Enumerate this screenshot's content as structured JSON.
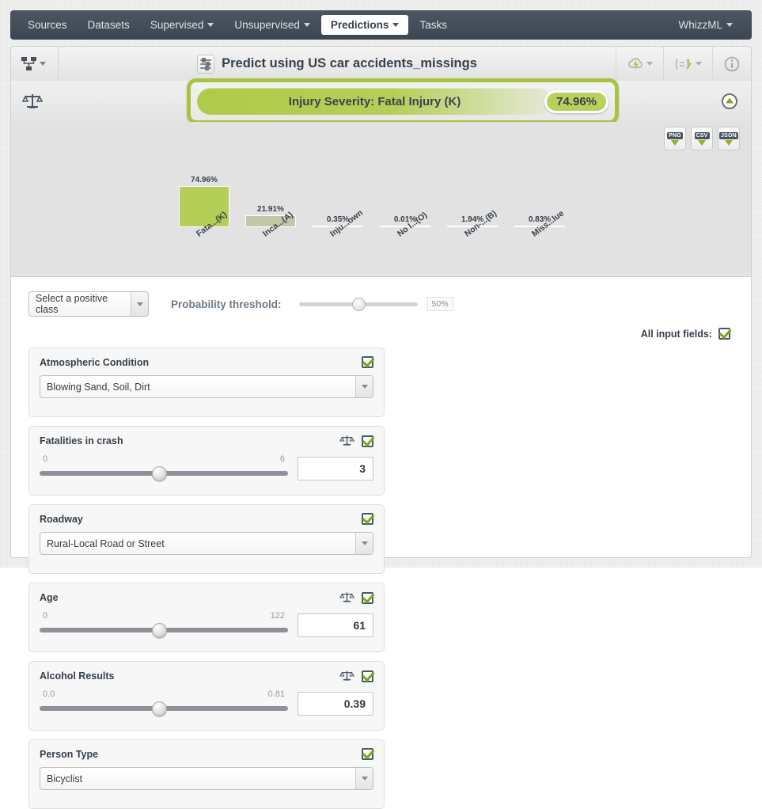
{
  "nav": {
    "items": [
      {
        "label": "Sources",
        "caret": false,
        "active": false
      },
      {
        "label": "Datasets",
        "caret": false,
        "active": false
      },
      {
        "label": "Supervised",
        "caret": true,
        "active": false
      },
      {
        "label": "Unsupervised",
        "caret": true,
        "active": false
      },
      {
        "label": "Predictions",
        "caret": true,
        "active": true
      },
      {
        "label": "Tasks",
        "caret": false,
        "active": false
      }
    ],
    "right": {
      "label": "WhizzML",
      "caret": true
    }
  },
  "toolbar": {
    "model_icon": "model-tree-icon",
    "title_icon": "sliders-icon",
    "title": "Predict using US car accidents_missings",
    "actions": [
      {
        "icon": "energy-cloud-icon",
        "caret": true
      },
      {
        "icon": "batch-prediction-icon",
        "caret": true
      },
      {
        "icon": "info-icon",
        "caret": false
      }
    ]
  },
  "banner": {
    "scale_icon": "balance-scale-icon",
    "prediction_label": "Injury Severity: Fatal Injury (K)",
    "probability": "74.96%",
    "collapse_icon": "collapse-up-icon",
    "accent_color": "#a6c440",
    "pill_color": "#b5ce57"
  },
  "chart_panel": {
    "downloads": [
      {
        "label": "PNG",
        "name": "download-png-button"
      },
      {
        "label": "CSV",
        "name": "download-csv-button"
      },
      {
        "label": "JSON",
        "name": "download-json-button"
      }
    ]
  },
  "chart_data": {
    "type": "bar",
    "title": "",
    "xlabel": "",
    "ylabel": "",
    "ylim": [
      0,
      100
    ],
    "grid": false,
    "legend": "none",
    "categories": [
      "Fata...(K)",
      "Inca...(A)",
      "Inju...own",
      "No I...(O)",
      "Non-...(B)",
      "Miss...lue"
    ],
    "values": [
      74.96,
      21.91,
      0.35,
      0.01,
      1.94,
      0.83
    ],
    "value_labels": [
      "74.96%",
      "21.91%",
      "0.35%",
      "0.01%",
      "1.94%",
      "0.83%"
    ],
    "colors": [
      "#b5ce57",
      "#c1c7a7",
      "#c1c7a7",
      "#c1c7a7",
      "#c1c7a7",
      "#c1c7a7"
    ]
  },
  "controls": {
    "positive_class": {
      "value": "Select a positive class",
      "name": "positive-class-select"
    },
    "threshold_label": "Probability threshold:",
    "threshold_value": "50%",
    "threshold_pct": 50,
    "all_input_fields_label": "All input fields:"
  },
  "fields": [
    {
      "name": "atmospheric-condition",
      "title": "Atmospheric Condition",
      "kind": "select",
      "value": "Blowing Sand, Soil, Dirt",
      "has_scale_icon": false,
      "checked": true
    },
    {
      "name": "fatalities-in-crash",
      "title": "Fatalities in crash",
      "kind": "slider",
      "min": "0",
      "max": "6",
      "value": "3",
      "fill_pct": 48,
      "has_scale_icon": true,
      "checked": true
    },
    {
      "name": "roadway",
      "title": "Roadway",
      "kind": "select",
      "value": "Rural-Local Road or Street",
      "has_scale_icon": false,
      "checked": true
    },
    {
      "name": "age",
      "title": "Age",
      "kind": "slider",
      "min": "0",
      "max": "122",
      "value": "61",
      "fill_pct": 48,
      "has_scale_icon": true,
      "checked": true
    },
    {
      "name": "alcohol-results",
      "title": "Alcohol Results",
      "kind": "slider",
      "min": "0.0",
      "max": "0.81",
      "value": "0.39",
      "fill_pct": 48,
      "has_scale_icon": true,
      "checked": true
    },
    {
      "name": "person-type",
      "title": "Person Type",
      "kind": "select",
      "value": "Bicyclist",
      "has_scale_icon": false,
      "checked": true
    }
  ]
}
